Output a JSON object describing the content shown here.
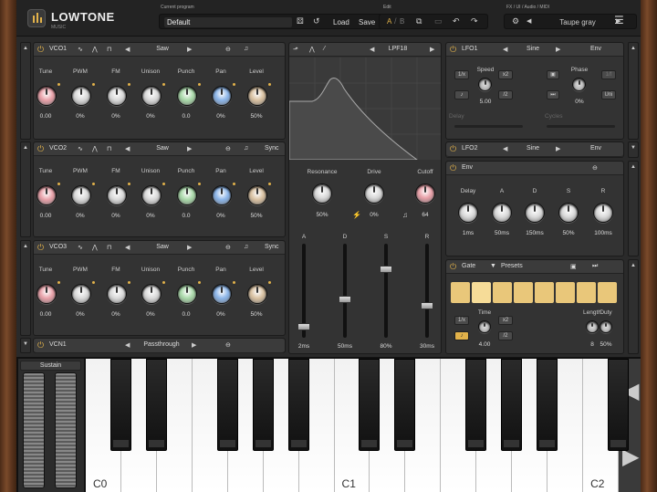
{
  "header": {
    "brand": "LOWTONE",
    "brand_sub": "MUSIC",
    "program_label": "Current program",
    "program": "Default",
    "load": "Load",
    "save": "Save",
    "edit_label": "Edit",
    "edit_a": "A",
    "edit_b": "B",
    "fx_label": "FX / UI / Audio / MIDI",
    "theme": "Taupe gray"
  },
  "vco1": {
    "title": "VCO1",
    "wave": "Saw"
  },
  "vco2": {
    "title": "VCO2",
    "wave": "Saw",
    "sync": "Sync"
  },
  "vco3": {
    "title": "VCO3",
    "wave": "Saw",
    "sync": "Sync"
  },
  "vcn1": {
    "title": "VCN1",
    "mode": "Passthrough"
  },
  "knob_labels": [
    "Tune",
    "PWM",
    "FM",
    "Unison",
    "Punch",
    "Pan",
    "Level"
  ],
  "vco1_vals": [
    "0.00",
    "0%",
    "0%",
    "0%",
    "0.0",
    "0%",
    "50%"
  ],
  "vco2_vals": [
    "0.00",
    "0%",
    "0%",
    "0%",
    "0.0",
    "0%",
    "50%"
  ],
  "vco3_vals": [
    "0.00",
    "0%",
    "0%",
    "0%",
    "0.0",
    "0%",
    "50%"
  ],
  "filter": {
    "type": "LPF18",
    "resonance_label": "Resonance",
    "drive_label": "Drive",
    "cutoff_label": "Cutoff",
    "resonance": "50%",
    "drive": "0%",
    "cutoff": "64"
  },
  "adsr": {
    "labels": [
      "A",
      "D",
      "S",
      "R"
    ],
    "values": [
      "2ms",
      "50ms",
      "80%",
      "30ms"
    ],
    "levels": [
      0.08,
      0.4,
      0.75,
      0.33
    ]
  },
  "lfo1": {
    "title": "LFO1",
    "wave": "Sine",
    "env": "Env",
    "speed_label": "Speed",
    "speed": "5.00",
    "phase_label": "Phase",
    "phase": "0%",
    "x2": "x2",
    "div2": "/2",
    "onex": "1/x",
    "uni": "Uni",
    "delay_label": "Delay",
    "cycles_label": "Cycles"
  },
  "lfo2": {
    "title": "LFO2",
    "wave": "Sine",
    "env": "Env"
  },
  "env": {
    "title": "Env",
    "labels": [
      "Delay",
      "A",
      "D",
      "S",
      "R"
    ],
    "values": [
      "1ms",
      "50ms",
      "150ms",
      "50%",
      "100ms"
    ]
  },
  "gate": {
    "title": "Gate",
    "presets": "Presets",
    "time_label": "Time",
    "time": "4.00",
    "length_label": "Length",
    "length": "8",
    "duty_label": "Duty",
    "duty": "50%",
    "onex": "1/x",
    "x2": "x2",
    "div2": "/2",
    "steps_active": [
      false,
      true,
      false,
      false,
      false,
      false,
      false,
      false
    ]
  },
  "keyboard": {
    "sustain": "Sustain",
    "octaves": [
      "C0",
      "C1",
      "C2"
    ]
  }
}
